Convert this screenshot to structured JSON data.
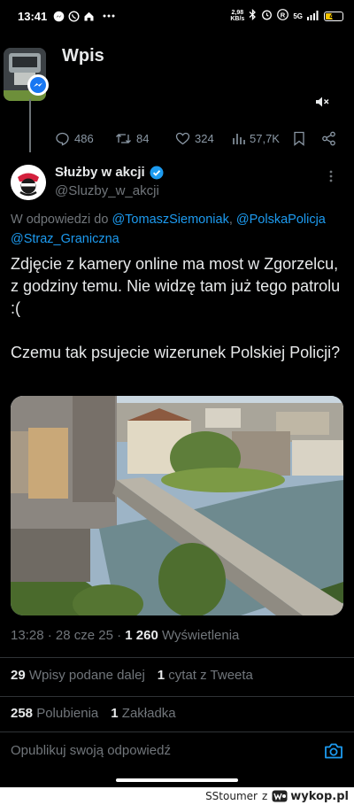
{
  "status_bar": {
    "time": "13:41",
    "icons": [
      "messenger-icon",
      "whatsapp-icon",
      "home-icon",
      "more-dots-icon"
    ],
    "net_speed_value": "2,98",
    "net_speed_unit": "KB/s",
    "network": "5G",
    "battery": "45"
  },
  "header": {
    "title": "Wpis"
  },
  "quoted_actions": {
    "replies": "486",
    "retweets": "84",
    "likes": "324",
    "views": "57,7K"
  },
  "tweet": {
    "display_name": "Służby w akcji",
    "verified": true,
    "handle": "@Sluzby_w_akcji",
    "reply_prefix": "W odpowiedzi do ",
    "mentions": [
      "@TomaszSiemoniak",
      "@PolskaPolicja",
      "@Straz_Graniczna"
    ],
    "text_line1": "Zdjęcie z kamery online ma most w Zgorzelcu, z godziny temu. Nie widzę tam już tego patrolu :(",
    "text_line2": "Czemu tak psujecie wizerunek Polskiej Policji?",
    "time": "13:28",
    "date": "28 cze 25",
    "views_count": "1 260",
    "views_label": "Wyświetlenia"
  },
  "stats": {
    "retweets_count": "29",
    "retweets_label": "Wpisy podane dalej",
    "quotes_count": "1",
    "quotes_label": "cytat z Tweeta",
    "likes_count": "258",
    "likes_label": "Polubienia",
    "bookmarks_count": "1",
    "bookmarks_label": "Zakładka"
  },
  "reply_box": {
    "placeholder": "Opublikuj swoją odpowiedź"
  },
  "footer": {
    "user": "SStoumer",
    "separator": "z",
    "site": "wykop.pl"
  },
  "colors": {
    "background": "#000000",
    "link": "#1d9bf0",
    "muted": "#71767b",
    "verified": "#1d9bf0",
    "footer_bg": "#ffffff"
  }
}
